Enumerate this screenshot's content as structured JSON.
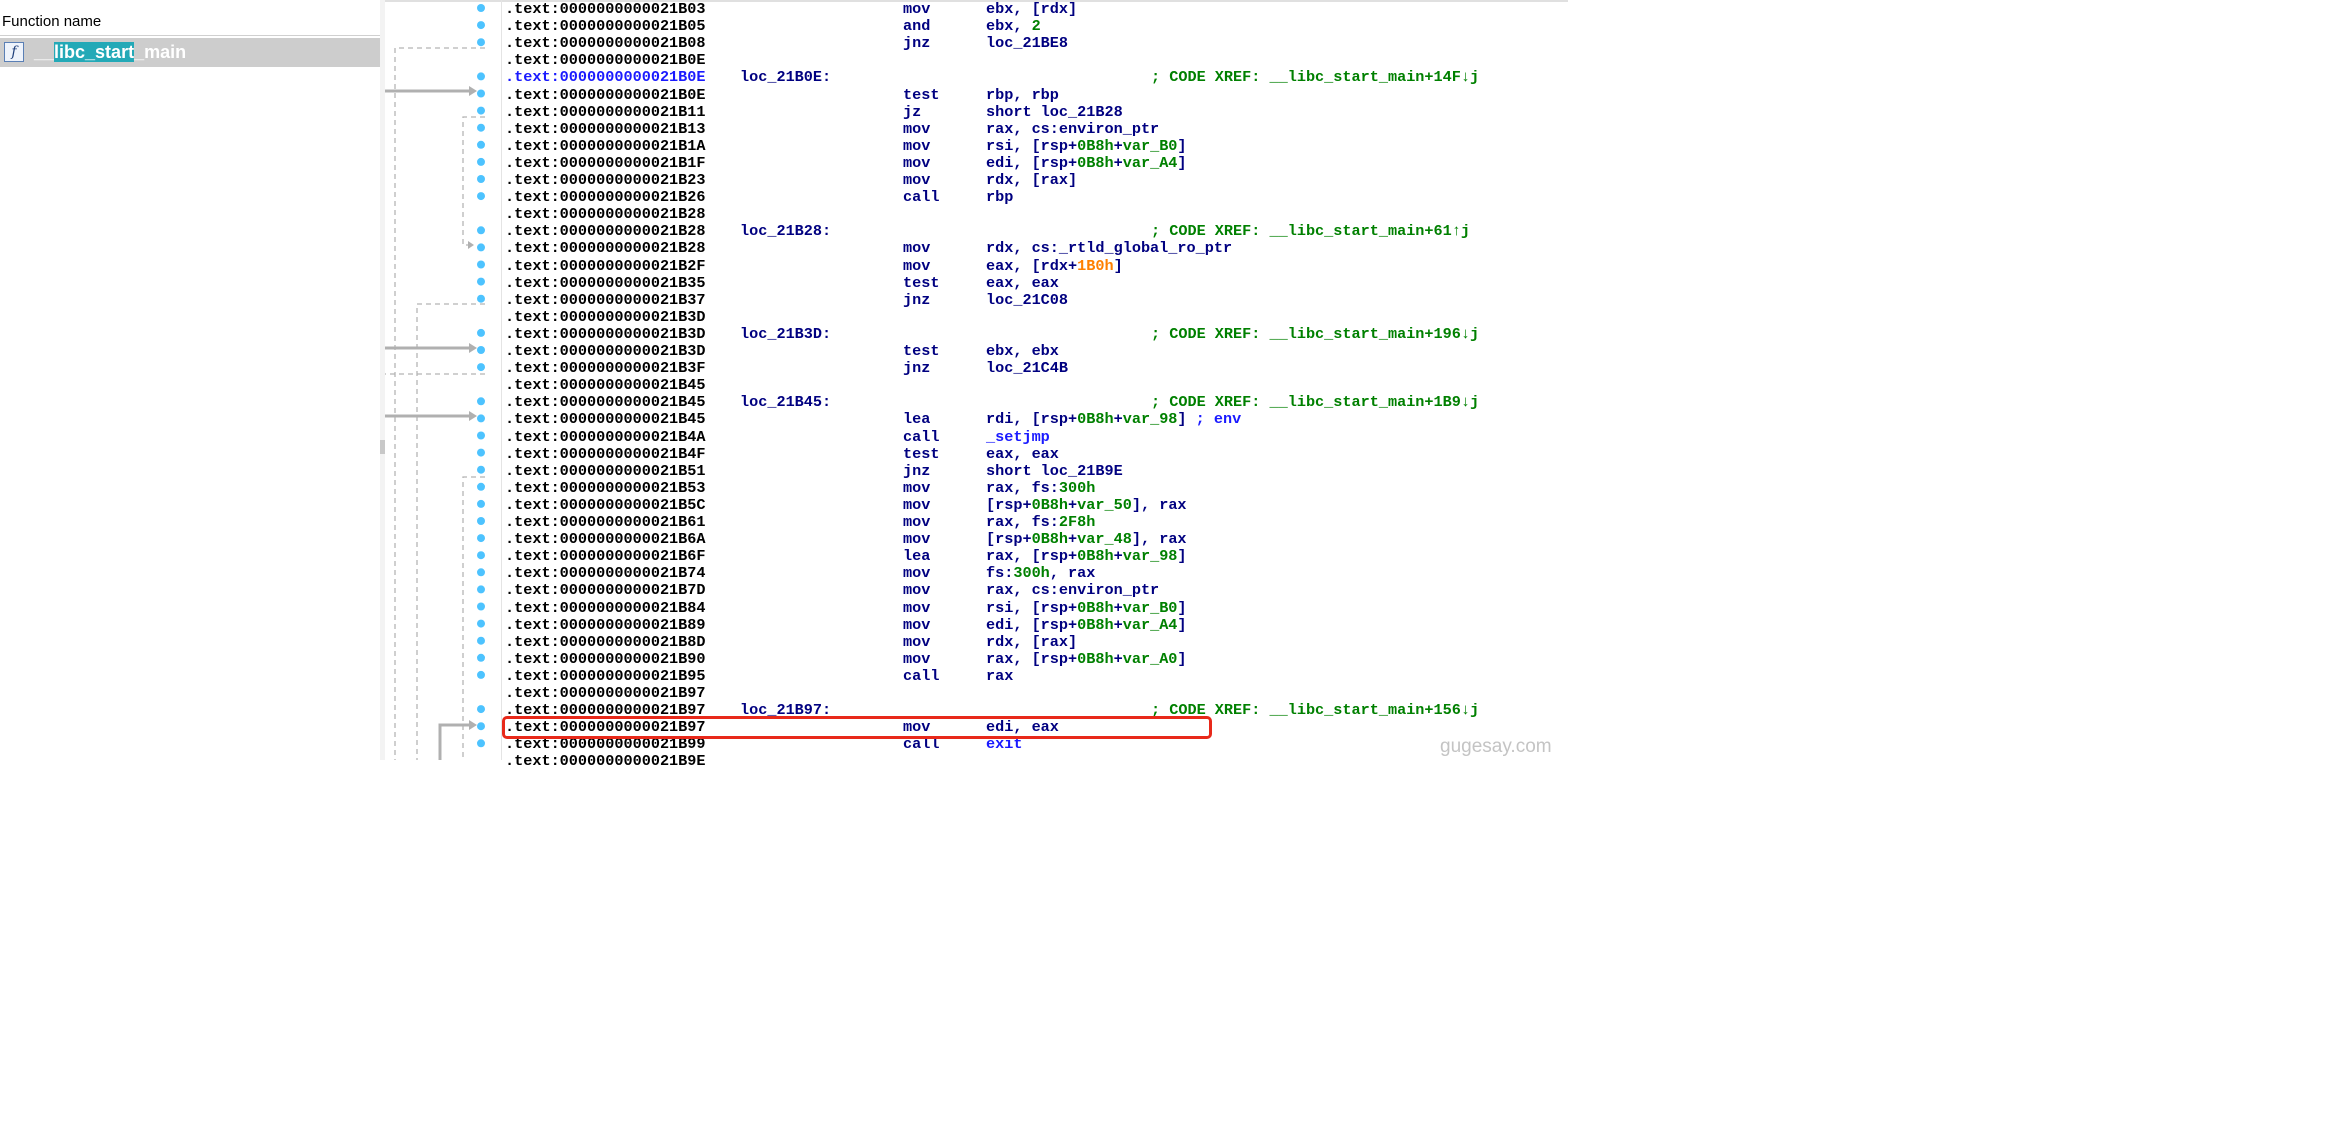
{
  "function_panel": {
    "header": "Function name",
    "functions": [
      {
        "name_prefix": "__",
        "name_highlight": "libc_start",
        "name_suffix": "_main",
        "icon": "function-icon",
        "icon_glyph": "f"
      }
    ]
  },
  "watermark": "gugesay.com",
  "colors": {
    "address": "#000000",
    "current_address": "#1a1aff",
    "label": "#000080",
    "mnemonic": "#000080",
    "comment": "#008000",
    "number": "#ff8000",
    "selection": "#23a9b7",
    "highlight_box": "#e8291a",
    "arrow_dot": "#4dc3ff"
  },
  "listing": [
    {
      "addr": ".text:0000000000021B03",
      "mn": "mov",
      "op": [
        [
          "ebx, [rdx]",
          ""
        ]
      ]
    },
    {
      "addr": ".text:0000000000021B05",
      "mn": "and",
      "op": [
        [
          "ebx, ",
          ""
        ],
        [
          "2",
          "g"
        ]
      ]
    },
    {
      "addr": ".text:0000000000021B08",
      "mn": "jnz",
      "op": [
        [
          "loc_21BE8",
          ""
        ]
      ]
    },
    {
      "addr": ".text:0000000000021B0E"
    },
    {
      "addr": ".text:0000000000021B0E",
      "cur": true,
      "label": "loc_21B0E:",
      "comment": "; CODE XREF: __libc_start_main+14F↓j"
    },
    {
      "addr": ".text:0000000000021B0E",
      "mn": "test",
      "op": [
        [
          "rbp, rbp",
          ""
        ]
      ]
    },
    {
      "addr": ".text:0000000000021B11",
      "mn": "jz",
      "op": [
        [
          "short loc_21B28",
          ""
        ]
      ]
    },
    {
      "addr": ".text:0000000000021B13",
      "mn": "mov",
      "op": [
        [
          "rax, cs:environ_ptr",
          ""
        ]
      ]
    },
    {
      "addr": ".text:0000000000021B1A",
      "mn": "mov",
      "op": [
        [
          "rsi, [rsp+",
          ""
        ],
        [
          "0B8h",
          "g"
        ],
        [
          "+",
          ""
        ],
        [
          "var_B0",
          "g"
        ],
        [
          "]",
          ""
        ]
      ]
    },
    {
      "addr": ".text:0000000000021B1F",
      "mn": "mov",
      "op": [
        [
          "edi, [rsp+",
          ""
        ],
        [
          "0B8h",
          "g"
        ],
        [
          "+",
          ""
        ],
        [
          "var_A4",
          "g"
        ],
        [
          "]",
          ""
        ]
      ]
    },
    {
      "addr": ".text:0000000000021B23",
      "mn": "mov",
      "op": [
        [
          "rdx, [rax]",
          ""
        ]
      ]
    },
    {
      "addr": ".text:0000000000021B26",
      "mn": "call",
      "op": [
        [
          "rbp",
          ""
        ]
      ]
    },
    {
      "addr": ".text:0000000000021B28"
    },
    {
      "addr": ".text:0000000000021B28",
      "label": "loc_21B28:",
      "comment": "; CODE XREF: __libc_start_main+61↑j"
    },
    {
      "addr": ".text:0000000000021B28",
      "mn": "mov",
      "op": [
        [
          "rdx, cs:_rtld_global_ro_ptr",
          ""
        ]
      ]
    },
    {
      "addr": ".text:0000000000021B2F",
      "mn": "mov",
      "op": [
        [
          "eax, [rdx+",
          ""
        ],
        [
          "1B0h",
          "o"
        ],
        [
          "]",
          ""
        ]
      ]
    },
    {
      "addr": ".text:0000000000021B35",
      "mn": "test",
      "op": [
        [
          "eax, eax",
          ""
        ]
      ]
    },
    {
      "addr": ".text:0000000000021B37",
      "mn": "jnz",
      "op": [
        [
          "loc_21C08",
          ""
        ]
      ]
    },
    {
      "addr": ".text:0000000000021B3D"
    },
    {
      "addr": ".text:0000000000021B3D",
      "label": "loc_21B3D:",
      "comment": "; CODE XREF: __libc_start_main+196↓j"
    },
    {
      "addr": ".text:0000000000021B3D",
      "mn": "test",
      "op": [
        [
          "ebx, ebx",
          ""
        ]
      ]
    },
    {
      "addr": ".text:0000000000021B3F",
      "mn": "jnz",
      "op": [
        [
          "loc_21C4B",
          ""
        ]
      ]
    },
    {
      "addr": ".text:0000000000021B45"
    },
    {
      "addr": ".text:0000000000021B45",
      "label": "loc_21B45:",
      "comment": "; CODE XREF: __libc_start_main+1B9↓j"
    },
    {
      "addr": ".text:0000000000021B45",
      "mn": "lea",
      "op": [
        [
          "rdi, [rsp+",
          ""
        ],
        [
          "0B8h",
          "g"
        ],
        [
          "+",
          ""
        ],
        [
          "var_98",
          "g"
        ],
        [
          "] ",
          ""
        ],
        [
          "; env",
          "b"
        ]
      ]
    },
    {
      "addr": ".text:0000000000021B4A",
      "mn": "call",
      "op": [
        [
          "_setjmp",
          "b"
        ]
      ]
    },
    {
      "addr": ".text:0000000000021B4F",
      "mn": "test",
      "op": [
        [
          "eax, eax",
          ""
        ]
      ]
    },
    {
      "addr": ".text:0000000000021B51",
      "mn": "jnz",
      "op": [
        [
          "short loc_21B9E",
          ""
        ]
      ]
    },
    {
      "addr": ".text:0000000000021B53",
      "mn": "mov",
      "op": [
        [
          "rax, fs:",
          ""
        ],
        [
          "300h",
          "g"
        ]
      ]
    },
    {
      "addr": ".text:0000000000021B5C",
      "mn": "mov",
      "op": [
        [
          "[rsp+",
          ""
        ],
        [
          "0B8h",
          "g"
        ],
        [
          "+",
          ""
        ],
        [
          "var_50",
          "g"
        ],
        [
          "], rax",
          ""
        ]
      ]
    },
    {
      "addr": ".text:0000000000021B61",
      "mn": "mov",
      "op": [
        [
          "rax, fs:",
          ""
        ],
        [
          "2F8h",
          "g"
        ]
      ]
    },
    {
      "addr": ".text:0000000000021B6A",
      "mn": "mov",
      "op": [
        [
          "[rsp+",
          ""
        ],
        [
          "0B8h",
          "g"
        ],
        [
          "+",
          ""
        ],
        [
          "var_48",
          "g"
        ],
        [
          "], rax",
          ""
        ]
      ]
    },
    {
      "addr": ".text:0000000000021B6F",
      "mn": "lea",
      "op": [
        [
          "rax, [rsp+",
          ""
        ],
        [
          "0B8h",
          "g"
        ],
        [
          "+",
          ""
        ],
        [
          "var_98",
          "g"
        ],
        [
          "]",
          ""
        ]
      ]
    },
    {
      "addr": ".text:0000000000021B74",
      "mn": "mov",
      "op": [
        [
          "fs:",
          ""
        ],
        [
          "300h",
          "g"
        ],
        [
          ", rax",
          ""
        ]
      ]
    },
    {
      "addr": ".text:0000000000021B7D",
      "mn": "mov",
      "op": [
        [
          "rax, cs:environ_ptr",
          ""
        ]
      ]
    },
    {
      "addr": ".text:0000000000021B84",
      "mn": "mov",
      "op": [
        [
          "rsi, [rsp+",
          ""
        ],
        [
          "0B8h",
          "g"
        ],
        [
          "+",
          ""
        ],
        [
          "var_B0",
          "g"
        ],
        [
          "]",
          ""
        ]
      ]
    },
    {
      "addr": ".text:0000000000021B89",
      "mn": "mov",
      "op": [
        [
          "edi, [rsp+",
          ""
        ],
        [
          "0B8h",
          "g"
        ],
        [
          "+",
          ""
        ],
        [
          "var_A4",
          "g"
        ],
        [
          "]",
          ""
        ]
      ]
    },
    {
      "addr": ".text:0000000000021B8D",
      "mn": "mov",
      "op": [
        [
          "rdx, [rax]",
          ""
        ]
      ]
    },
    {
      "addr": ".text:0000000000021B90",
      "mn": "mov",
      "op": [
        [
          "rax, [rsp+",
          ""
        ],
        [
          "0B8h",
          "g"
        ],
        [
          "+",
          ""
        ],
        [
          "var_A0",
          "g"
        ],
        [
          "]",
          ""
        ]
      ]
    },
    {
      "addr": ".text:0000000000021B95",
      "mn": "call",
      "op": [
        [
          "rax",
          ""
        ]
      ]
    },
    {
      "addr": ".text:0000000000021B97"
    },
    {
      "addr": ".text:0000000000021B97",
      "label": "loc_21B97:",
      "comment": "; CODE XREF: __libc_start_main+156↓j"
    },
    {
      "addr": ".text:0000000000021B97",
      "mn": "mov",
      "op": [
        [
          "edi, eax",
          ""
        ]
      ],
      "highlighted": true
    },
    {
      "addr": ".text:0000000000021B99",
      "mn": "call",
      "op": [
        [
          "exit",
          "b"
        ]
      ]
    },
    {
      "addr": ".text:0000000000021B9E"
    }
  ]
}
